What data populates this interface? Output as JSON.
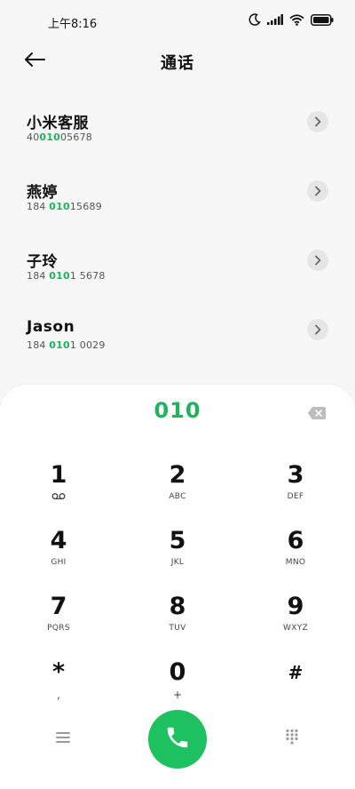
{
  "status_bar": {
    "time": "上午8:16"
  },
  "header": {
    "title": "通话"
  },
  "contacts": [
    {
      "name": "小米客服",
      "number_pre": "40",
      "number_match": "010",
      "number_post": "05678"
    },
    {
      "name": "燕婷",
      "number_pre": "184 ",
      "number_match": "010",
      "number_post": "15689"
    },
    {
      "name": "子玲",
      "number_pre": "184 ",
      "number_match": "010",
      "number_post": "1 5678"
    },
    {
      "name": "Jason",
      "number_pre": "184 ",
      "number_match": "010",
      "number_post": "1 0029"
    }
  ],
  "dialer": {
    "input": "010",
    "keys": [
      {
        "digit": "1",
        "sub": ""
      },
      {
        "digit": "2",
        "sub": "ABC"
      },
      {
        "digit": "3",
        "sub": "DEF"
      },
      {
        "digit": "4",
        "sub": "GHI"
      },
      {
        "digit": "5",
        "sub": "JKL"
      },
      {
        "digit": "6",
        "sub": "MNO"
      },
      {
        "digit": "7",
        "sub": "PQRS"
      },
      {
        "digit": "8",
        "sub": "TUV"
      },
      {
        "digit": "9",
        "sub": "WXYZ"
      },
      {
        "digit": "*",
        "sub": ","
      },
      {
        "digit": "0",
        "sub": "+"
      },
      {
        "digit": "#",
        "sub": ""
      }
    ]
  },
  "icons": {
    "voicemail": "voicemail-icon",
    "back": "back-arrow-icon",
    "detail": "chevron-right-icon",
    "backspace": "backspace-icon",
    "menu": "menu-icon",
    "call": "phone-icon",
    "keypad": "keypad-icon"
  },
  "colors": {
    "accent": "#1fb35c",
    "call_button": "#1ec15f"
  }
}
